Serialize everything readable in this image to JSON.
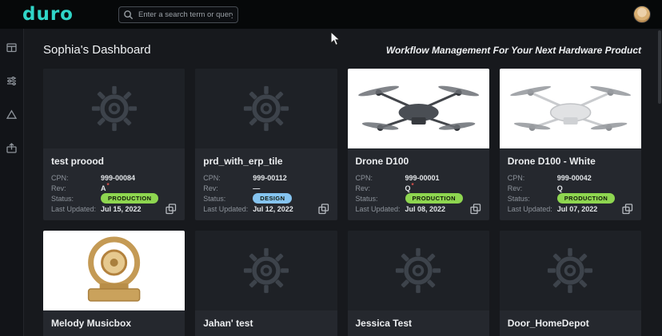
{
  "header": {
    "logo": "duro",
    "search_placeholder": "Enter a search term or query"
  },
  "sidebar": {
    "items": [
      {
        "icon": "storage-box-icon"
      },
      {
        "icon": "filter-sliders-icon"
      },
      {
        "icon": "triangle-icon"
      },
      {
        "icon": "export-box-icon"
      }
    ]
  },
  "page": {
    "title": "Sophia's Dashboard",
    "tagline": "Workflow Management For Your Next Hardware Product"
  },
  "labels": {
    "cpn": "CPN:",
    "rev": "Rev:",
    "status": "Status:",
    "last_updated": "Last Updated:"
  },
  "status_colors": {
    "PRODUCTION": "#8ed650",
    "DESIGN": "#85c4f0"
  },
  "brand_color": "#30d5c8",
  "cards": [
    {
      "title": "test proood",
      "cpn": "999-00084",
      "rev": "A",
      "rev_flag": true,
      "status": "PRODUCTION",
      "last_updated": "Jul 15, 2022",
      "image": "gear"
    },
    {
      "title": "prd_with_erp_tile",
      "cpn": "999-00112",
      "rev": "—",
      "rev_flag": false,
      "status": "DESIGN",
      "last_updated": "Jul 12, 2022",
      "image": "gear"
    },
    {
      "title": "Drone D100",
      "cpn": "999-00001",
      "rev": "Q",
      "rev_flag": true,
      "status": "PRODUCTION",
      "last_updated": "Jul 08, 2022",
      "image": "drone-dark"
    },
    {
      "title": "Drone D100 - White",
      "cpn": "999-00042",
      "rev": "Q",
      "rev_flag": false,
      "status": "PRODUCTION",
      "last_updated": "Jul 07, 2022",
      "image": "drone-white"
    },
    {
      "title": "Melody Musicbox",
      "image": "musicbox"
    },
    {
      "title": "Jahan' test",
      "image": "gear"
    },
    {
      "title": "Jessica Test",
      "image": "gear"
    },
    {
      "title": "Door_HomeDepot",
      "image": "gear"
    }
  ]
}
